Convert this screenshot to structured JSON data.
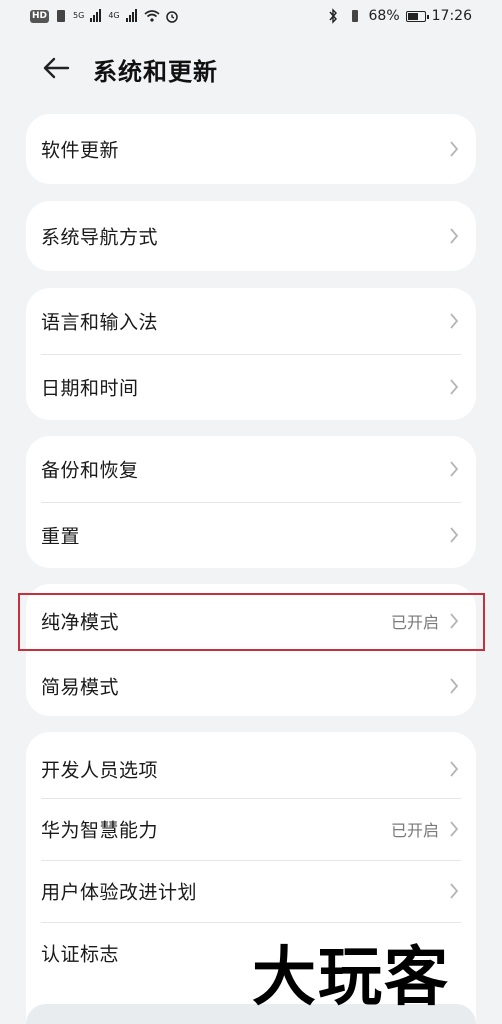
{
  "status_bar": {
    "left_badge": "HD",
    "network_labels": [
      "5G",
      "4G"
    ],
    "battery_percent": "68%",
    "battery_level": 0.68,
    "time": "17:26"
  },
  "header": {
    "title": "系统和更新",
    "back_icon": "arrow-left-icon"
  },
  "groups": [
    {
      "items": [
        {
          "label": "软件更新",
          "value": ""
        }
      ]
    },
    {
      "items": [
        {
          "label": "系统导航方式",
          "value": ""
        }
      ]
    },
    {
      "items": [
        {
          "label": "语言和输入法",
          "value": ""
        },
        {
          "label": "日期和时间",
          "value": ""
        }
      ]
    },
    {
      "items": [
        {
          "label": "备份和恢复",
          "value": ""
        },
        {
          "label": "重置",
          "value": ""
        }
      ]
    },
    {
      "items": [
        {
          "label": "纯净模式",
          "value": "已开启"
        },
        {
          "label": "简易模式",
          "value": ""
        }
      ]
    },
    {
      "items": [
        {
          "label": "开发人员选项",
          "value": ""
        },
        {
          "label": "华为智慧能力",
          "value": "已开启"
        },
        {
          "label": "用户体验改进计划",
          "value": ""
        },
        {
          "label": "认证标志",
          "value": ""
        }
      ]
    }
  ],
  "watermark": "大玩客",
  "colors": {
    "background": "#f1f3f5",
    "card": "#ffffff",
    "highlight": "#c5303f"
  }
}
